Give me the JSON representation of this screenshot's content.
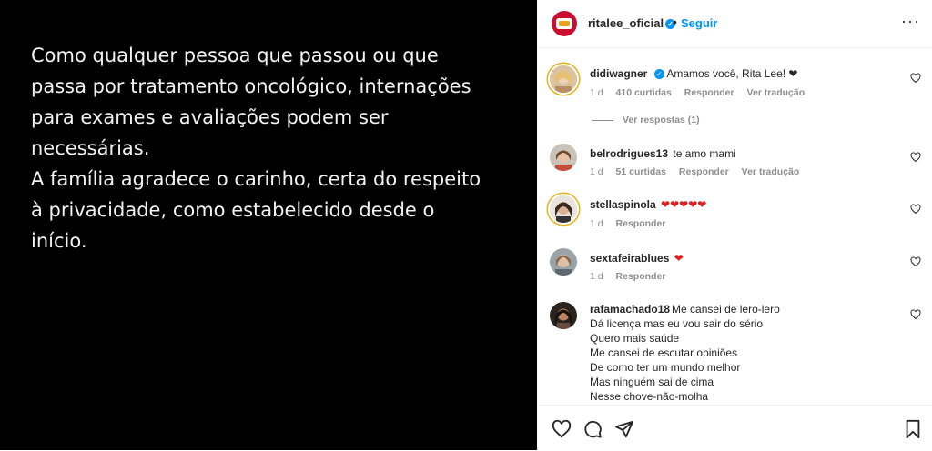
{
  "post": {
    "caption": "Como qualquer pessoa que passou ou que\npassa por tratamento oncológico, internações\npara exames e avaliações podem ser\nnecessárias.\nA família agradece o carinho, certa do respeito\nà privacidade, como estabelecido desde o\ninício."
  },
  "header": {
    "username": "ritalee_oficial",
    "dot": "•",
    "follow_label": "Seguir",
    "more_label": "···"
  },
  "comments": [
    {
      "username": "didiwagner",
      "text": "Amamos você, Rita Lee! ❤",
      "time": "1 d",
      "likes": "410 curtidas",
      "reply": "Responder",
      "translate": "Ver tradução",
      "view_replies": "Ver respostas (1)"
    },
    {
      "username": "belrodrigues13",
      "text": "te amo mami",
      "time": "1 d",
      "likes": "51 curtidas",
      "reply": "Responder",
      "translate": "Ver tradução"
    },
    {
      "username": "stellaspinola",
      "text": "❤❤❤❤❤",
      "time": "1 d",
      "reply": "Responder"
    },
    {
      "username": "sextafeirablues",
      "text": "❤",
      "time": "1 d",
      "reply": "Responder"
    },
    {
      "username": "rafamachado18",
      "text": "Me cansei de lero-lero\nDá licença mas eu vou sair do sério\nQuero mais saúde\nMe cansei de escutar opiniões\nDe como ter um mundo melhor\nMas ninguém sai de cima\nNesse chove-não-molha"
    }
  ],
  "icons": {
    "like": "heart-outline-icon",
    "comment": "comment-bubble-icon",
    "share": "paper-plane-icon",
    "save": "bookmark-icon"
  },
  "colors": {
    "accent": "#0095f6",
    "heart": "#e02020",
    "muted": "#8e8e8e"
  }
}
